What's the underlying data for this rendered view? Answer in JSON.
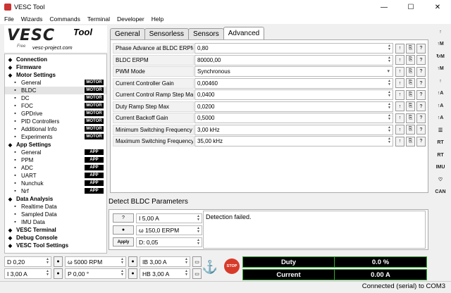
{
  "window": {
    "title": "VESC Tool",
    "minimize": "—",
    "maximize": "☐",
    "close": "✕"
  },
  "menu": [
    "File",
    "Wizards",
    "Commands",
    "Terminal",
    "Developer",
    "Help"
  ],
  "logo": {
    "vesc": "VESC",
    "tool": "Tool",
    "free": "Free",
    "url": "vesc-project.com"
  },
  "nav": [
    {
      "label": "Connection",
      "level": 0,
      "icon": "connection-icon"
    },
    {
      "label": "Firmware",
      "level": 0,
      "icon": "firmware-icon"
    },
    {
      "label": "Motor Settings",
      "level": 0,
      "icon": "motor-settings-icon"
    },
    {
      "label": "General",
      "level": 1,
      "icon": "general-icon",
      "badge": "MOTOR"
    },
    {
      "label": "BLDC",
      "level": 1,
      "icon": "bldc-icon",
      "badge": "MOTOR",
      "selected": true
    },
    {
      "label": "DC",
      "level": 1,
      "icon": "dc-icon",
      "badge": "MOTOR"
    },
    {
      "label": "FOC",
      "level": 1,
      "icon": "foc-icon",
      "badge": "MOTOR"
    },
    {
      "label": "GPDrive",
      "level": 1,
      "icon": "gpdrive-icon",
      "badge": "MOTOR"
    },
    {
      "label": "PID Controllers",
      "level": 1,
      "icon": "pid-icon",
      "badge": "MOTOR"
    },
    {
      "label": "Additional Info",
      "level": 1,
      "icon": "info-icon",
      "badge": "MOTOR"
    },
    {
      "label": "Experiments",
      "level": 1,
      "icon": "experiments-icon",
      "badge": "MOTOR"
    },
    {
      "label": "App Settings",
      "level": 0,
      "icon": "app-settings-icon"
    },
    {
      "label": "General",
      "level": 1,
      "icon": "general-icon",
      "badge": "APP"
    },
    {
      "label": "PPM",
      "level": 1,
      "icon": "ppm-icon",
      "badge": "APP"
    },
    {
      "label": "ADC",
      "level": 1,
      "icon": "adc-icon",
      "badge": "APP"
    },
    {
      "label": "UART",
      "level": 1,
      "icon": "uart-icon",
      "badge": "APP"
    },
    {
      "label": "Nunchuk",
      "level": 1,
      "icon": "nunchuk-icon",
      "badge": "APP"
    },
    {
      "label": "Nrf",
      "level": 1,
      "icon": "nrf-icon",
      "badge": "APP"
    },
    {
      "label": "Data Analysis",
      "level": 0,
      "icon": "data-analysis-icon"
    },
    {
      "label": "Realtime Data",
      "level": 1,
      "icon": "realtime-icon"
    },
    {
      "label": "Sampled Data",
      "level": 1,
      "icon": "sampled-icon"
    },
    {
      "label": "IMU Data",
      "level": 1,
      "icon": "imu-icon"
    },
    {
      "label": "VESC Terminal",
      "level": 0,
      "icon": "terminal-icon"
    },
    {
      "label": "Debug Console",
      "level": 0,
      "icon": "debug-icon"
    },
    {
      "label": "VESC Tool Settings",
      "level": 0,
      "icon": "settings-icon"
    }
  ],
  "tabs": [
    {
      "label": "General",
      "active": false
    },
    {
      "label": "Sensorless",
      "active": false
    },
    {
      "label": "Sensors",
      "active": false
    },
    {
      "label": "Advanced",
      "active": true
    }
  ],
  "params": [
    {
      "label": "Phase Advance at BLDC ERPM",
      "value": "0,80",
      "kind": "spin"
    },
    {
      "label": "BLDC ERPM",
      "value": "80000,00",
      "kind": "spin"
    },
    {
      "label": "PWM Mode",
      "value": "Synchronous",
      "kind": "dropdown"
    },
    {
      "label": "Current Controller Gain",
      "value": "0,00460",
      "kind": "spin"
    },
    {
      "label": "Current Control Ramp Step Max",
      "value": "0,0400",
      "kind": "spin"
    },
    {
      "label": "Duty Ramp Step Max",
      "value": "0,0200",
      "kind": "spin"
    },
    {
      "label": "Current Backoff Gain",
      "value": "0,5000",
      "kind": "spin"
    },
    {
      "label": "Minimum Switching Frequency",
      "value": "3,00 kHz",
      "kind": "spin"
    },
    {
      "label": "Maximum Switching Frequency",
      "value": "35,00 kHz",
      "kind": "spin"
    }
  ],
  "param_buttons": {
    "upload": "↑",
    "copy": "⎘",
    "help": "?"
  },
  "detect": {
    "title": "Detect BLDC Parameters",
    "current": "I 5,00 A",
    "erpm": "ω 150,0 ERPM",
    "duty": "D: 0,05",
    "apply": "Apply",
    "result": "Detection failed."
  },
  "right_toolbar": [
    "↑",
    "↑M",
    "↻M",
    "↑M",
    "↑",
    "↑A",
    "↑A",
    "↑A",
    "☰",
    "RT",
    "RT",
    "IMU",
    "♡",
    "CAN"
  ],
  "controls": {
    "duty": "D 0,20",
    "rpm": "ω 5000 RPM",
    "ib": "IB 3,00 A",
    "current": "I 3,00 A",
    "position": "P 0,00 °",
    "hb": "HB 3,00 A",
    "stop": "STOP"
  },
  "readouts": [
    {
      "label": "Duty",
      "value": "0.0 %"
    },
    {
      "label": "Current",
      "value": "0.00 A"
    }
  ],
  "status": "Connected (serial) to COM3"
}
